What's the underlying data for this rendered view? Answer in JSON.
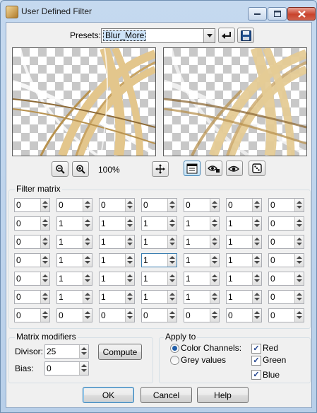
{
  "window": {
    "title": "User Defined Filter"
  },
  "presets": {
    "label": "Presets:",
    "value": "Blur_More"
  },
  "zoom": {
    "level": "100%"
  },
  "matrix": {
    "title": "Filter matrix",
    "rows": [
      [
        "0",
        "0",
        "0",
        "0",
        "0",
        "0",
        "0"
      ],
      [
        "0",
        "1",
        "1",
        "1",
        "1",
        "1",
        "0"
      ],
      [
        "0",
        "1",
        "1",
        "1",
        "1",
        "1",
        "0"
      ],
      [
        "0",
        "1",
        "1",
        "1",
        "1",
        "1",
        "0"
      ],
      [
        "0",
        "1",
        "1",
        "1",
        "1",
        "1",
        "0"
      ],
      [
        "0",
        "1",
        "1",
        "1",
        "1",
        "1",
        "0"
      ],
      [
        "0",
        "0",
        "0",
        "0",
        "0",
        "0",
        "0"
      ]
    ]
  },
  "modifiers": {
    "title": "Matrix modifiers",
    "divisor_label": "Divisor:",
    "divisor": "25",
    "bias_label": "Bias:",
    "bias": "0",
    "compute_label": "Compute"
  },
  "apply_to": {
    "title": "Apply to",
    "color_channels": "Color Channels:",
    "grey_values": "Grey values",
    "red": "Red",
    "green": "Green",
    "blue": "Blue"
  },
  "buttons": {
    "ok": "OK",
    "cancel": "Cancel",
    "help": "Help"
  },
  "colors": {
    "strand_light": "#e3c68c",
    "strand_dark": "#b8924f",
    "strand_deep": "#8d6a36",
    "checker": "#c8c8c8"
  }
}
